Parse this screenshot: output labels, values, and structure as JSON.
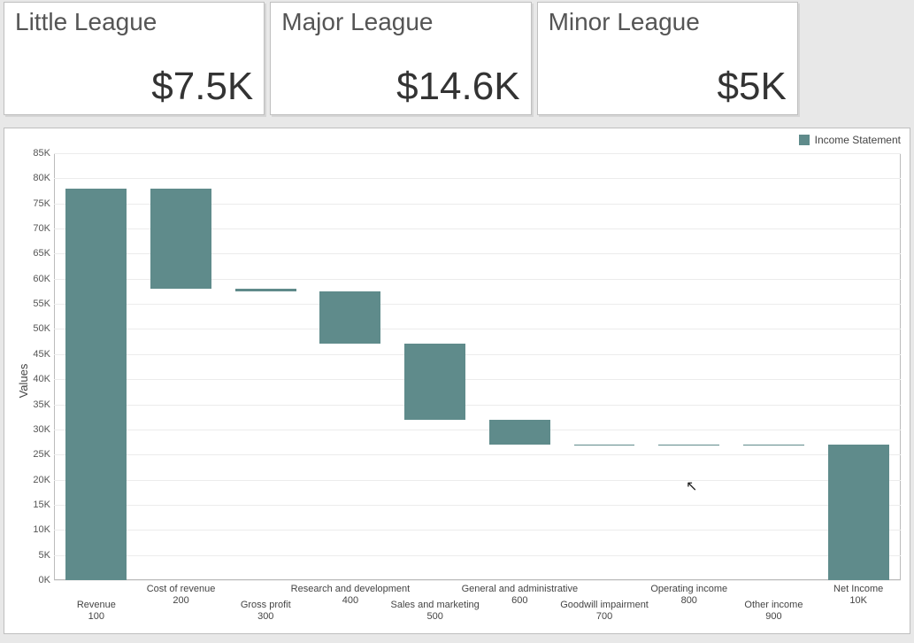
{
  "cards": [
    {
      "title": "Little League",
      "value": "$7.5K"
    },
    {
      "title": "Major League",
      "value": "$14.6K"
    },
    {
      "title": "Minor League",
      "value": "$5K"
    }
  ],
  "legend": {
    "label": "Income Statement",
    "color": "#5f8b8b"
  },
  "ylabel": "Values",
  "chart_data": {
    "type": "bar",
    "title": "",
    "xlabel": "",
    "ylabel": "Values",
    "ylim": [
      0,
      85000
    ],
    "y_ticks": [
      0,
      5000,
      10000,
      15000,
      20000,
      25000,
      30000,
      35000,
      40000,
      45000,
      50000,
      55000,
      60000,
      65000,
      70000,
      75000,
      80000,
      85000
    ],
    "y_tick_labels": [
      "0K",
      "5K",
      "10K",
      "15K",
      "20K",
      "25K",
      "30K",
      "35K",
      "40K",
      "45K",
      "50K",
      "55K",
      "60K",
      "65K",
      "70K",
      "75K",
      "80K",
      "85K"
    ],
    "series_name": "Income Statement",
    "series_color": "#5f8b8b",
    "categories": [
      {
        "label": "Revenue",
        "sub": "100",
        "bottom": 0,
        "top": 78000
      },
      {
        "label": "Cost of revenue",
        "sub": "200",
        "bottom": 58000,
        "top": 78000
      },
      {
        "label": "Gross profit",
        "sub": "300",
        "bottom": 57500,
        "top": 58000
      },
      {
        "label": "Research and development",
        "sub": "400",
        "bottom": 47000,
        "top": 57500
      },
      {
        "label": "Sales and marketing",
        "sub": "500",
        "bottom": 32000,
        "top": 47000
      },
      {
        "label": "General and administrative",
        "sub": "600",
        "bottom": 27000,
        "top": 32000
      },
      {
        "label": "Goodwill impairment",
        "sub": "700",
        "bottom": 26800,
        "top": 27000
      },
      {
        "label": "Operating income",
        "sub": "800",
        "bottom": 26800,
        "top": 27000
      },
      {
        "label": "Other income",
        "sub": "900",
        "bottom": 26800,
        "top": 27000
      },
      {
        "label": "Net Income",
        "sub": "10K",
        "bottom": 0,
        "top": 27000
      }
    ]
  }
}
